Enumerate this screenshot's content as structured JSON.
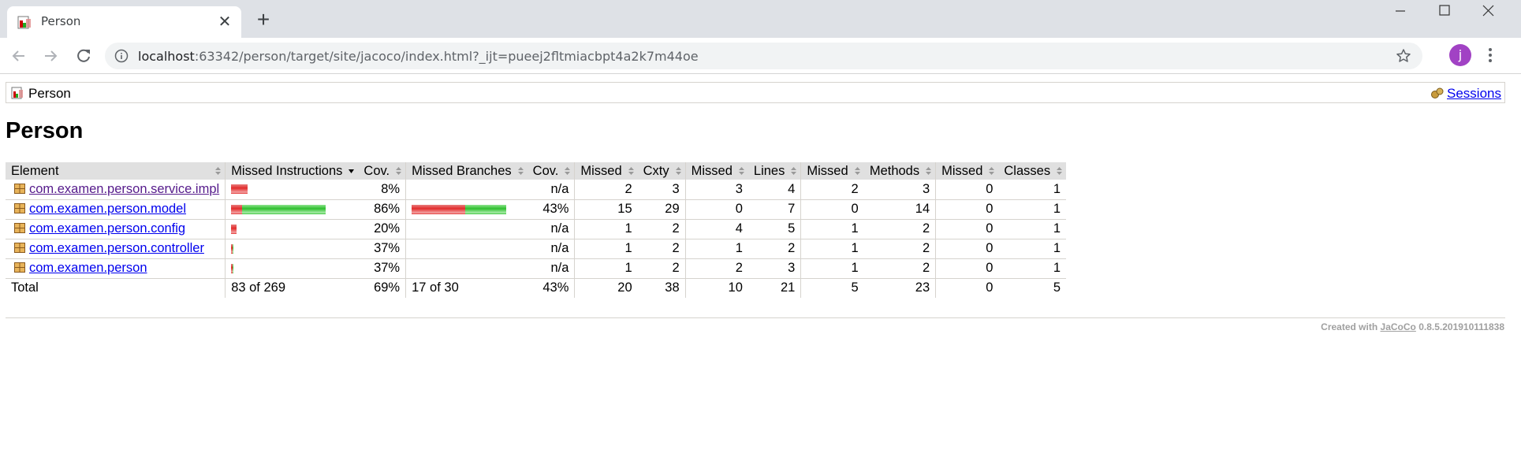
{
  "browser": {
    "tab_title": "Person",
    "tab_close": "✕",
    "new_tab": "+",
    "url_host": "localhost",
    "url_rest": ":63342/person/target/site/jacoco/index.html?_ijt=pueej2fltmiacbpt4a2k7m44oe",
    "avatar_initial": "j",
    "icons": {
      "back": "arrow-left-icon",
      "forward": "arrow-right-icon",
      "reload": "reload-icon",
      "info": "info-icon",
      "star": "star-icon",
      "menu": "kebab-menu-icon"
    }
  },
  "breadcrumb": {
    "label": "Person",
    "sessions_link": "Sessions"
  },
  "page": {
    "title": "Person"
  },
  "table": {
    "headers": [
      "Element",
      "Missed Instructions",
      "Cov.",
      "Missed Branches",
      "Cov.",
      "Missed",
      "Cxty",
      "Missed",
      "Lines",
      "Missed",
      "Methods",
      "Missed",
      "Classes"
    ],
    "rows": [
      {
        "name": "com.examen.person.service.impl",
        "visited": true,
        "instr_bar": {
          "missed_fraction": 0.173,
          "covered_fraction": 0.0
        },
        "instr_cov": "8%",
        "branch_bar": null,
        "branch_cov": "n/a",
        "missed_cxty": "2",
        "cxty": "3",
        "missed_lines": "3",
        "lines": "4",
        "missed_methods": "2",
        "methods": "3",
        "missed_classes": "0",
        "classes": "1"
      },
      {
        "name": "com.examen.person.model",
        "visited": false,
        "instr_bar": {
          "missed_fraction": 0.12,
          "covered_fraction": 0.88
        },
        "instr_cov": "86%",
        "branch_bar": {
          "missed_fraction": 0.57,
          "covered_fraction": 0.43
        },
        "branch_cov": "43%",
        "missed_cxty": "15",
        "cxty": "29",
        "missed_lines": "0",
        "lines": "7",
        "missed_methods": "0",
        "methods": "14",
        "missed_classes": "0",
        "classes": "1"
      },
      {
        "name": "com.examen.person.config",
        "visited": false,
        "instr_bar": {
          "missed_fraction": 0.058,
          "covered_fraction": 0.0
        },
        "instr_cov": "20%",
        "branch_bar": null,
        "branch_cov": "n/a",
        "missed_cxty": "1",
        "cxty": "2",
        "missed_lines": "4",
        "lines": "5",
        "missed_methods": "1",
        "methods": "2",
        "missed_classes": "0",
        "classes": "1"
      },
      {
        "name": "com.examen.person.controller",
        "visited": false,
        "instr_bar": {
          "missed_fraction": 0.017,
          "covered_fraction": 0.008
        },
        "instr_cov": "37%",
        "branch_bar": null,
        "branch_cov": "n/a",
        "missed_cxty": "1",
        "cxty": "2",
        "missed_lines": "1",
        "lines": "2",
        "missed_methods": "1",
        "methods": "2",
        "missed_classes": "0",
        "classes": "1"
      },
      {
        "name": "com.examen.person",
        "visited": false,
        "instr_bar": {
          "missed_fraction": 0.017,
          "covered_fraction": 0.008
        },
        "instr_cov": "37%",
        "branch_bar": null,
        "branch_cov": "n/a",
        "missed_cxty": "1",
        "cxty": "2",
        "missed_lines": "2",
        "lines": "3",
        "missed_methods": "1",
        "methods": "2",
        "missed_classes": "0",
        "classes": "1"
      }
    ],
    "total": {
      "label": "Total",
      "instr": "83 of 269",
      "instr_cov": "69%",
      "branch": "17 of 30",
      "branch_cov": "43%",
      "missed_cxty": "20",
      "cxty": "38",
      "missed_lines": "10",
      "lines": "21",
      "missed_methods": "5",
      "methods": "23",
      "missed_classes": "0",
      "classes": "5"
    }
  },
  "footer": {
    "prefix": "Created with",
    "link": "JaCoCo",
    "version": "0.8.5.201910111838"
  },
  "colors": {
    "tabstrip": "#dee1e6",
    "header_bg": "#e0e0e0",
    "bar_missed": "#e32c2c",
    "bar_covered": "#2fbf2f",
    "avatar": "#a142c4"
  }
}
